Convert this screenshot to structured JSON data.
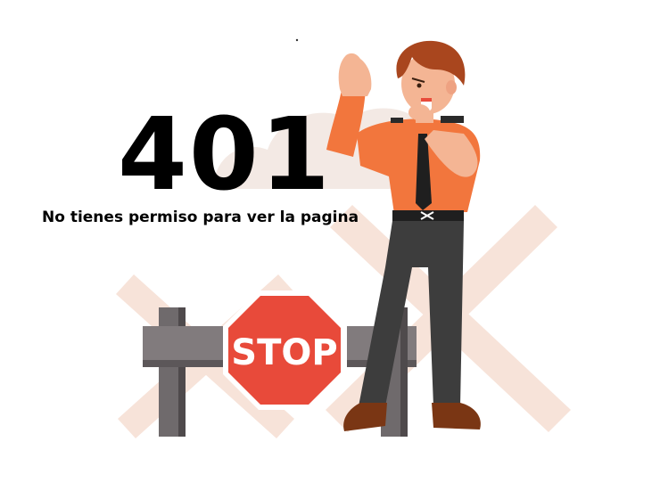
{
  "error": {
    "code": "401",
    "message": "No tienes permiso para ver la pagina"
  },
  "illustration": {
    "sign_text": "STOP",
    "icons": [
      "cloud-icon",
      "cross-barrier-icon",
      "fence-post-icon",
      "stop-sign-icon",
      "security-guard-icon"
    ]
  },
  "colors": {
    "text": "#000000",
    "stop_sign": "#e84a3a",
    "shirt": "#f2763d",
    "hair": "#a9461e",
    "trousers": "#3d3d3d",
    "shoes": "#7a3614",
    "fence": "#6f6a6c",
    "cross_backdrop": "#f7e3d9",
    "cloud": "#f3e9e4"
  }
}
